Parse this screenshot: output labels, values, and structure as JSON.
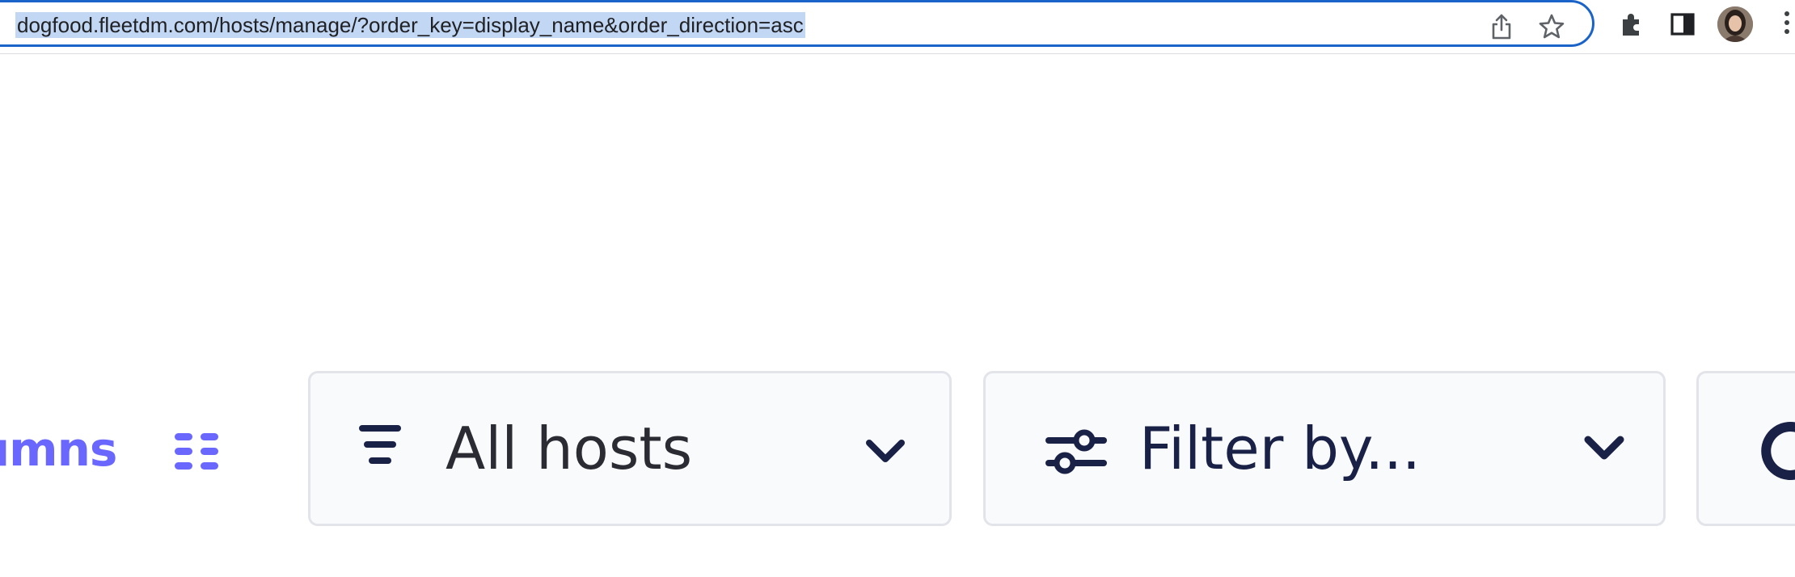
{
  "browser": {
    "url": "dogfood.fleetdm.com/hosts/manage/?order_key=display_name&order_direction=asc",
    "icons": [
      "share-icon",
      "star-icon",
      "extensions-icon",
      "side-panel-icon",
      "profile-avatar",
      "menu-icon"
    ]
  },
  "toolbar": {
    "columns_label": "lumns",
    "columns_icon": "columns-grid-icon"
  },
  "host_filter": {
    "label": "All hosts",
    "lead_icon": "filter-lines-icon",
    "trailing_icon": "chevron-down-icon"
  },
  "label_filter": {
    "label": "Filter by...",
    "lead_icon": "sliders-icon",
    "trailing_icon": "chevron-down-icon"
  },
  "colors": {
    "accent": "#6a67fe",
    "text_dark": "#192147",
    "border": "#e2e4ea",
    "dropdown_bg": "#f9fafc",
    "url_highlight": "#c2d7f3",
    "omnibox_border": "#1a63c9"
  }
}
